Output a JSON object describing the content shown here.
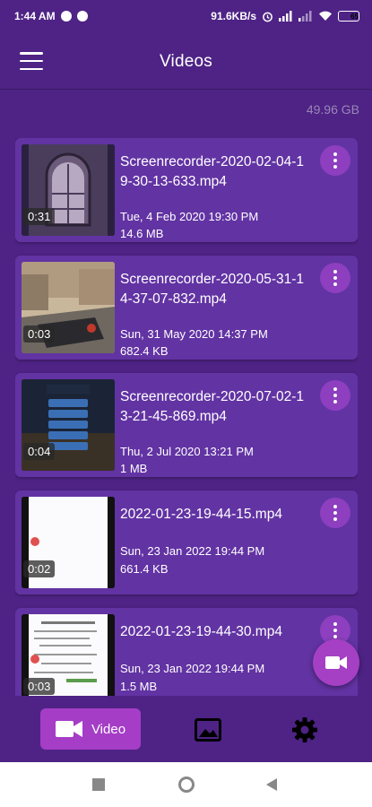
{
  "status_bar": {
    "time": "1:44 AM",
    "speed": "91.6KB/s",
    "battery": "65"
  },
  "app_bar": {
    "title": "Videos"
  },
  "storage": {
    "free": "49.96 GB"
  },
  "videos": [
    {
      "name": "Screenrecorder-2020-02-04-19-30-13-633.mp4",
      "date": "Tue, 4 Feb 2020 19:30 PM",
      "size": "14.6 MB",
      "duration": "0:31"
    },
    {
      "name": "Screenrecorder-2020-05-31-14-37-07-832.mp4",
      "date": "Sun, 31 May 2020 14:37 PM",
      "size": "682.4 KB",
      "duration": "0:03"
    },
    {
      "name": "Screenrecorder-2020-07-02-13-21-45-869.mp4",
      "date": "Thu, 2 Jul 2020 13:21 PM",
      "size": "1 MB",
      "duration": "0:04"
    },
    {
      "name": "2022-01-23-19-44-15.mp4",
      "date": "Sun, 23 Jan 2022 19:44 PM",
      "size": "661.4 KB",
      "duration": "0:02"
    },
    {
      "name": "2022-01-23-19-44-30.mp4",
      "date": "Sun, 23 Jan 2022 19:44 PM",
      "size": "1.5 MB",
      "duration": "0:03"
    }
  ],
  "bottom_nav": {
    "video_label": "Video"
  },
  "colors": {
    "background": "#4e2385",
    "card": "#6233a3",
    "accent": "#a53dc6"
  },
  "icons": {
    "menu": "hamburger-icon",
    "more": "more-vert-icon",
    "fab": "videocam-icon",
    "image": "image-icon",
    "settings": "gear-icon"
  }
}
